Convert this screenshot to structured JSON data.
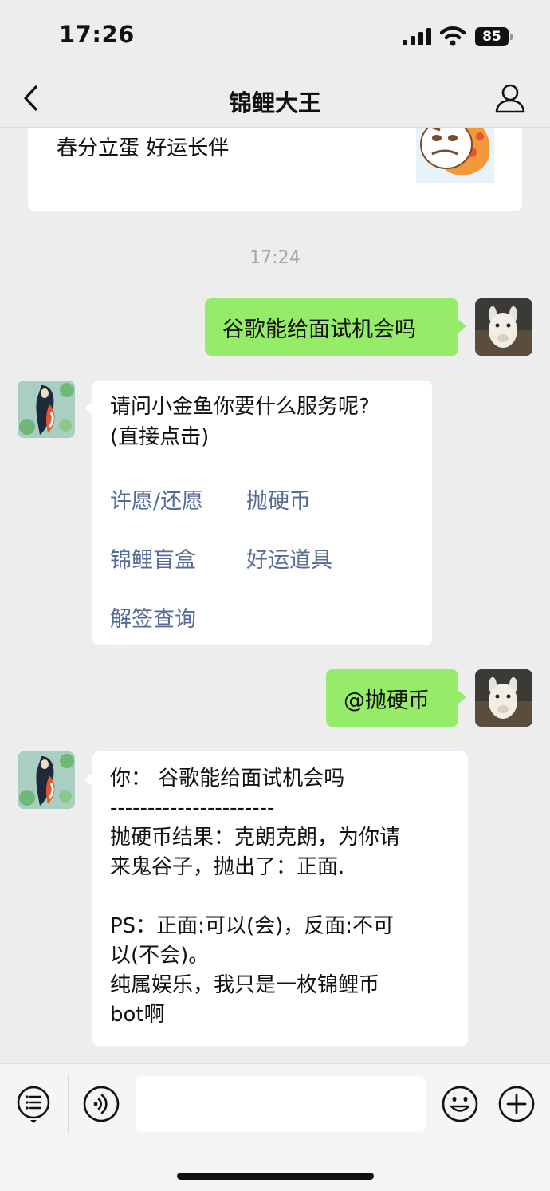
{
  "status_bar": {
    "time": "17:26",
    "battery": "85"
  },
  "nav": {
    "title": "锦鲤大王"
  },
  "messages": {
    "card": {
      "text": "春分立蛋 好运长伴"
    },
    "timestamp": "17:24",
    "user_msg_1": "谷歌能给面试机会吗",
    "bot_menu": {
      "line1": "请问小金鱼你要什么服务呢?",
      "line2": "(直接点击)",
      "options": [
        "许愿/还愿",
        "抛硬币",
        "锦鲤盲盒",
        "好运道具",
        "解签查询"
      ]
    },
    "user_msg_2": "@抛硬币",
    "bot_result": {
      "lines": [
        "你：  谷歌能给面试机会吗",
        "----------------------",
        "抛硬币结果：克朗克朗，为你请",
        "来鬼谷子，抛出了：正面.",
        "",
        "PS：正面:可以(会)，反面:不可",
        "以(不会)。",
        "纯属娱乐，我只是一枚锦鲤币",
        "bot啊"
      ]
    }
  },
  "colors": {
    "sent_bubble": "#95ec69",
    "link": "#576b95",
    "background": "#ededed"
  },
  "icons": [
    "back-icon",
    "profile-icon",
    "signal-icon",
    "wifi-icon",
    "battery-icon",
    "menu-list-icon",
    "voice-icon",
    "emoji-icon",
    "plus-icon"
  ]
}
